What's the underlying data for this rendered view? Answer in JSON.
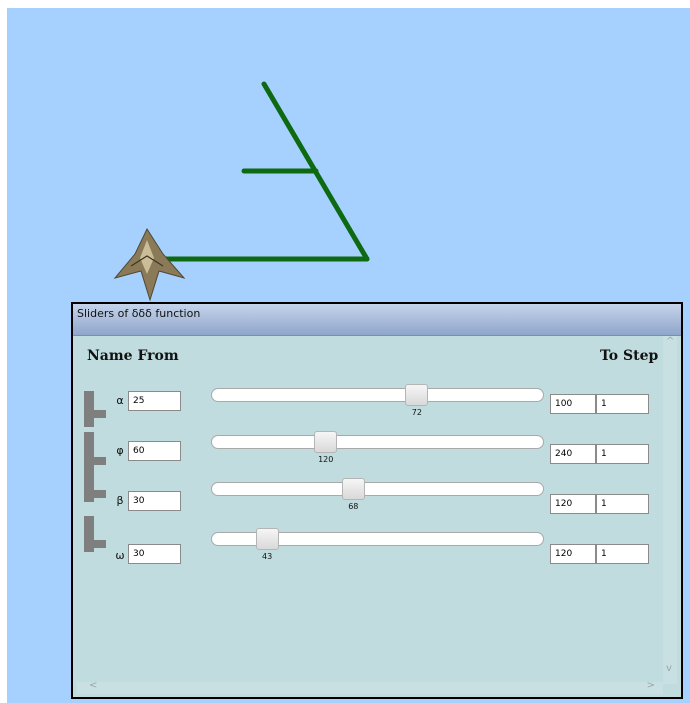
{
  "panel": {
    "title": "Sliders of δδδ function",
    "header_name_from": "Name From",
    "header_to_step": "To Step"
  },
  "sliders": [
    {
      "name": "α",
      "from": "25",
      "value": "72",
      "to": "100",
      "step": "1",
      "fraction": 0.627
    },
    {
      "name": "φ",
      "from": "60",
      "value": "120",
      "to": "240",
      "step": "1",
      "fraction": 0.333
    },
    {
      "name": "β",
      "from": "30",
      "value": "68",
      "to": "120",
      "step": "1",
      "fraction": 0.422
    },
    {
      "name": "ω",
      "from": "30",
      "value": "43",
      "to": "120",
      "step": "1",
      "fraction": 0.144
    }
  ],
  "scroll_arrows": {
    "up": "^",
    "down": "v",
    "left": "<",
    "right": ">"
  },
  "colors": {
    "canvas": "#a6d1fe",
    "line": "#0d6a12",
    "panel_body": "#c0dcdf",
    "titlebar_top": "#c5d4ea",
    "titlebar_bottom": "#8fa6cc"
  },
  "icons": [
    "turtle-icon",
    "drag-handle-icon"
  ]
}
